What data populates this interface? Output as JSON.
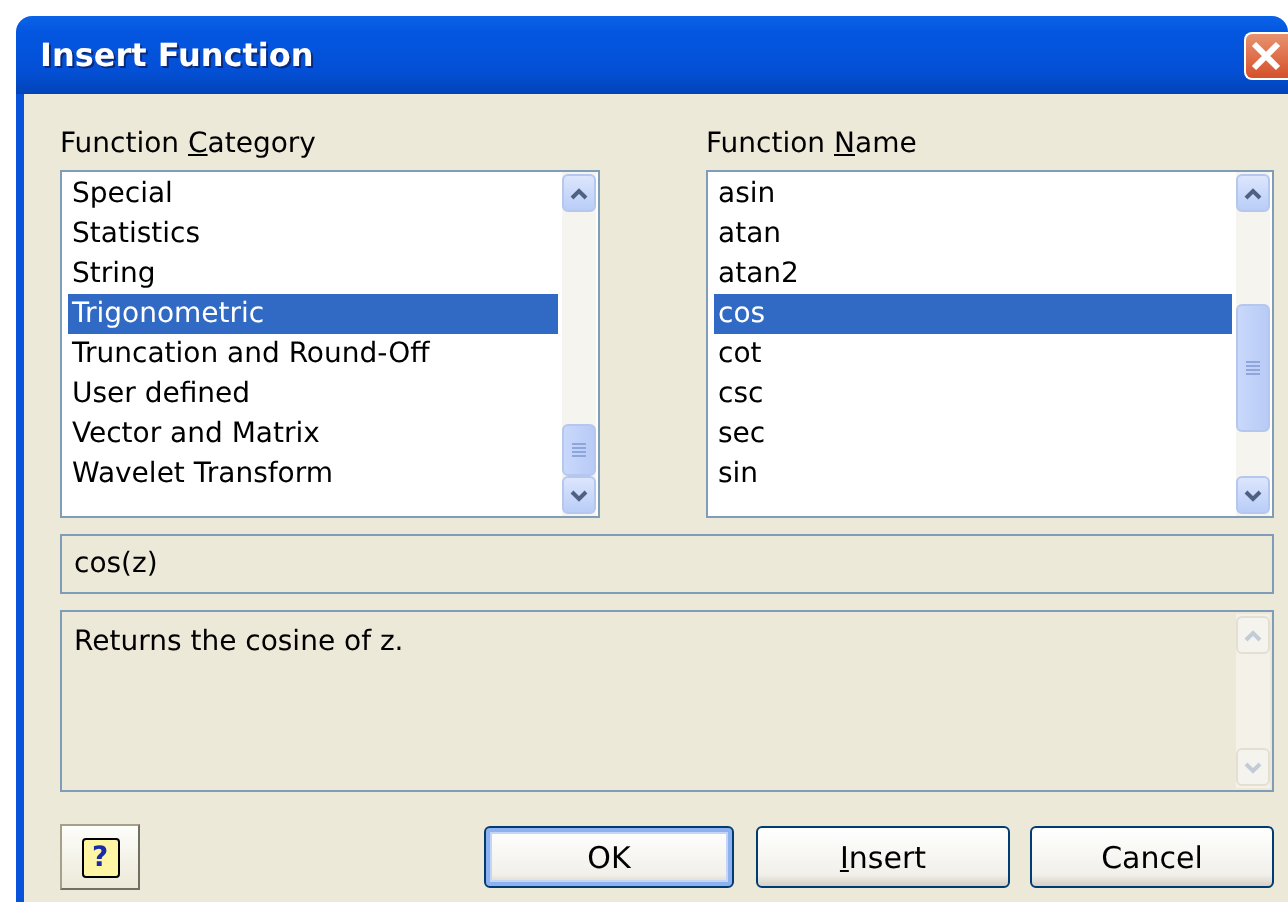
{
  "window": {
    "title": "Insert Function"
  },
  "category": {
    "label": {
      "before": "Function ",
      "key": "C",
      "after": "ategory"
    },
    "items": [
      {
        "text": "Special",
        "selected": false
      },
      {
        "text": "Statistics",
        "selected": false
      },
      {
        "text": "String",
        "selected": false
      },
      {
        "text": "Trigonometric",
        "selected": true
      },
      {
        "text": "Truncation and Round-Off",
        "selected": false
      },
      {
        "text": "User defined",
        "selected": false
      },
      {
        "text": "Vector and Matrix",
        "selected": false
      },
      {
        "text": "Wavelet Transform",
        "selected": false
      }
    ]
  },
  "function_name": {
    "label": {
      "before": "Function ",
      "key": "N",
      "after": "ame"
    },
    "items": [
      {
        "text": "asin",
        "selected": false
      },
      {
        "text": "atan",
        "selected": false
      },
      {
        "text": "atan2",
        "selected": false
      },
      {
        "text": "cos",
        "selected": true
      },
      {
        "text": "cot",
        "selected": false
      },
      {
        "text": "csc",
        "selected": false
      },
      {
        "text": "sec",
        "selected": false
      },
      {
        "text": "sin",
        "selected": false
      }
    ]
  },
  "signature": "cos(z)",
  "description": "Returns the cosine of z.",
  "help_button": {
    "glyph": "?"
  },
  "buttons": [
    {
      "label": {
        "before": "OK"
      },
      "default": true
    },
    {
      "label": {
        "key": "I",
        "after": "nsert"
      },
      "default": false
    },
    {
      "label": {
        "before": "Cancel"
      },
      "default": false
    }
  ]
}
